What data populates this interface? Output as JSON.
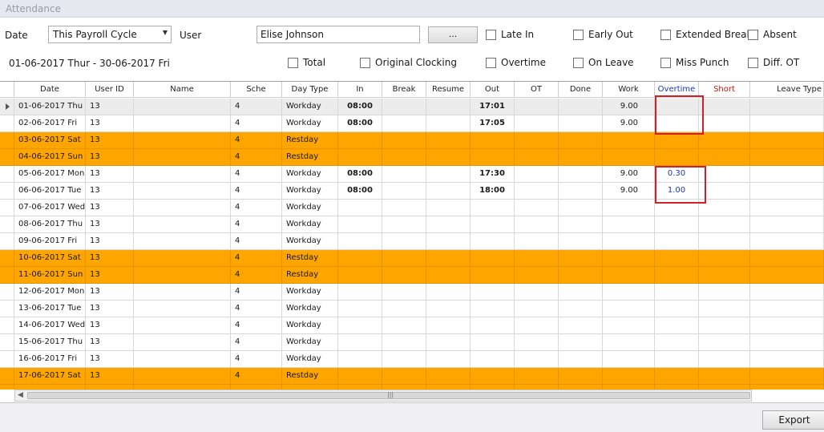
{
  "window": {
    "title": "Attendance"
  },
  "filters": {
    "date_label": "Date",
    "date_select": "This Payroll Cycle",
    "user_label": "User",
    "user_value": "Elise Johnson",
    "browse_label": "...",
    "date_range": "01-06-2017 Thur - 30-06-2017 Fri",
    "checkboxes": [
      "Late In",
      "Early Out",
      "Extended Break",
      "Absent",
      "Total",
      "Original Clocking",
      "Overtime",
      "On Leave",
      "Miss Punch",
      "Diff. OT"
    ]
  },
  "grid": {
    "columns": [
      "Date",
      "User ID",
      "Name",
      "Sche",
      "Day Type",
      "In",
      "Break",
      "Resume",
      "Out",
      "OT",
      "Done",
      "Work",
      "Overtime",
      "Short",
      "Leave Type"
    ],
    "rows": [
      {
        "date": "01-06-2017  Thu",
        "uid": "13",
        "sche": "4",
        "daytype": "Workday",
        "in": "08:00",
        "out": "17:01",
        "work": "9.00",
        "overtime": "",
        "rest": false
      },
      {
        "date": "02-06-2017  Fri",
        "uid": "13",
        "sche": "4",
        "daytype": "Workday",
        "in": "08:00",
        "out": "17:05",
        "work": "9.00",
        "overtime": "",
        "rest": false
      },
      {
        "date": "03-06-2017  Sat",
        "uid": "13",
        "sche": "4",
        "daytype": "Restday",
        "in": "",
        "out": "",
        "work": "",
        "overtime": "",
        "rest": true
      },
      {
        "date": "04-06-2017  Sun",
        "uid": "13",
        "sche": "4",
        "daytype": "Restday",
        "in": "",
        "out": "",
        "work": "",
        "overtime": "",
        "rest": true
      },
      {
        "date": "05-06-2017  Mon",
        "uid": "13",
        "sche": "4",
        "daytype": "Workday",
        "in": "08:00",
        "out": "17:30",
        "work": "9.00",
        "overtime": "0.30",
        "rest": false
      },
      {
        "date": "06-06-2017  Tue",
        "uid": "13",
        "sche": "4",
        "daytype": "Workday",
        "in": "08:00",
        "out": "18:00",
        "work": "9.00",
        "overtime": "1.00",
        "rest": false
      },
      {
        "date": "07-06-2017  Wed",
        "uid": "13",
        "sche": "4",
        "daytype": "Workday",
        "in": "",
        "out": "",
        "work": "",
        "overtime": "",
        "rest": false
      },
      {
        "date": "08-06-2017  Thu",
        "uid": "13",
        "sche": "4",
        "daytype": "Workday",
        "in": "",
        "out": "",
        "work": "",
        "overtime": "",
        "rest": false
      },
      {
        "date": "09-06-2017  Fri",
        "uid": "13",
        "sche": "4",
        "daytype": "Workday",
        "in": "",
        "out": "",
        "work": "",
        "overtime": "",
        "rest": false
      },
      {
        "date": "10-06-2017  Sat",
        "uid": "13",
        "sche": "4",
        "daytype": "Restday",
        "in": "",
        "out": "",
        "work": "",
        "overtime": "",
        "rest": true
      },
      {
        "date": "11-06-2017  Sun",
        "uid": "13",
        "sche": "4",
        "daytype": "Restday",
        "in": "",
        "out": "",
        "work": "",
        "overtime": "",
        "rest": true
      },
      {
        "date": "12-06-2017  Mon",
        "uid": "13",
        "sche": "4",
        "daytype": "Workday",
        "in": "",
        "out": "",
        "work": "",
        "overtime": "",
        "rest": false
      },
      {
        "date": "13-06-2017  Tue",
        "uid": "13",
        "sche": "4",
        "daytype": "Workday",
        "in": "",
        "out": "",
        "work": "",
        "overtime": "",
        "rest": false
      },
      {
        "date": "14-06-2017  Wed",
        "uid": "13",
        "sche": "4",
        "daytype": "Workday",
        "in": "",
        "out": "",
        "work": "",
        "overtime": "",
        "rest": false
      },
      {
        "date": "15-06-2017  Thu",
        "uid": "13",
        "sche": "4",
        "daytype": "Workday",
        "in": "",
        "out": "",
        "work": "",
        "overtime": "",
        "rest": false
      },
      {
        "date": "16-06-2017  Fri",
        "uid": "13",
        "sche": "4",
        "daytype": "Workday",
        "in": "",
        "out": "",
        "work": "",
        "overtime": "",
        "rest": false
      },
      {
        "date": "17-06-2017  Sat",
        "uid": "13",
        "sche": "4",
        "daytype": "Restday",
        "in": "",
        "out": "",
        "work": "",
        "overtime": "",
        "rest": true
      },
      {
        "date": "",
        "uid": "",
        "sche": "",
        "daytype": "",
        "in": "",
        "out": "",
        "work": "",
        "overtime": "",
        "rest": true
      }
    ]
  },
  "footer": {
    "export_label": "Export"
  },
  "colors": {
    "restday": "#ffa500",
    "overtime_header": "#1c35b8",
    "short_header": "#d01010",
    "highlight": "#d0202c"
  }
}
